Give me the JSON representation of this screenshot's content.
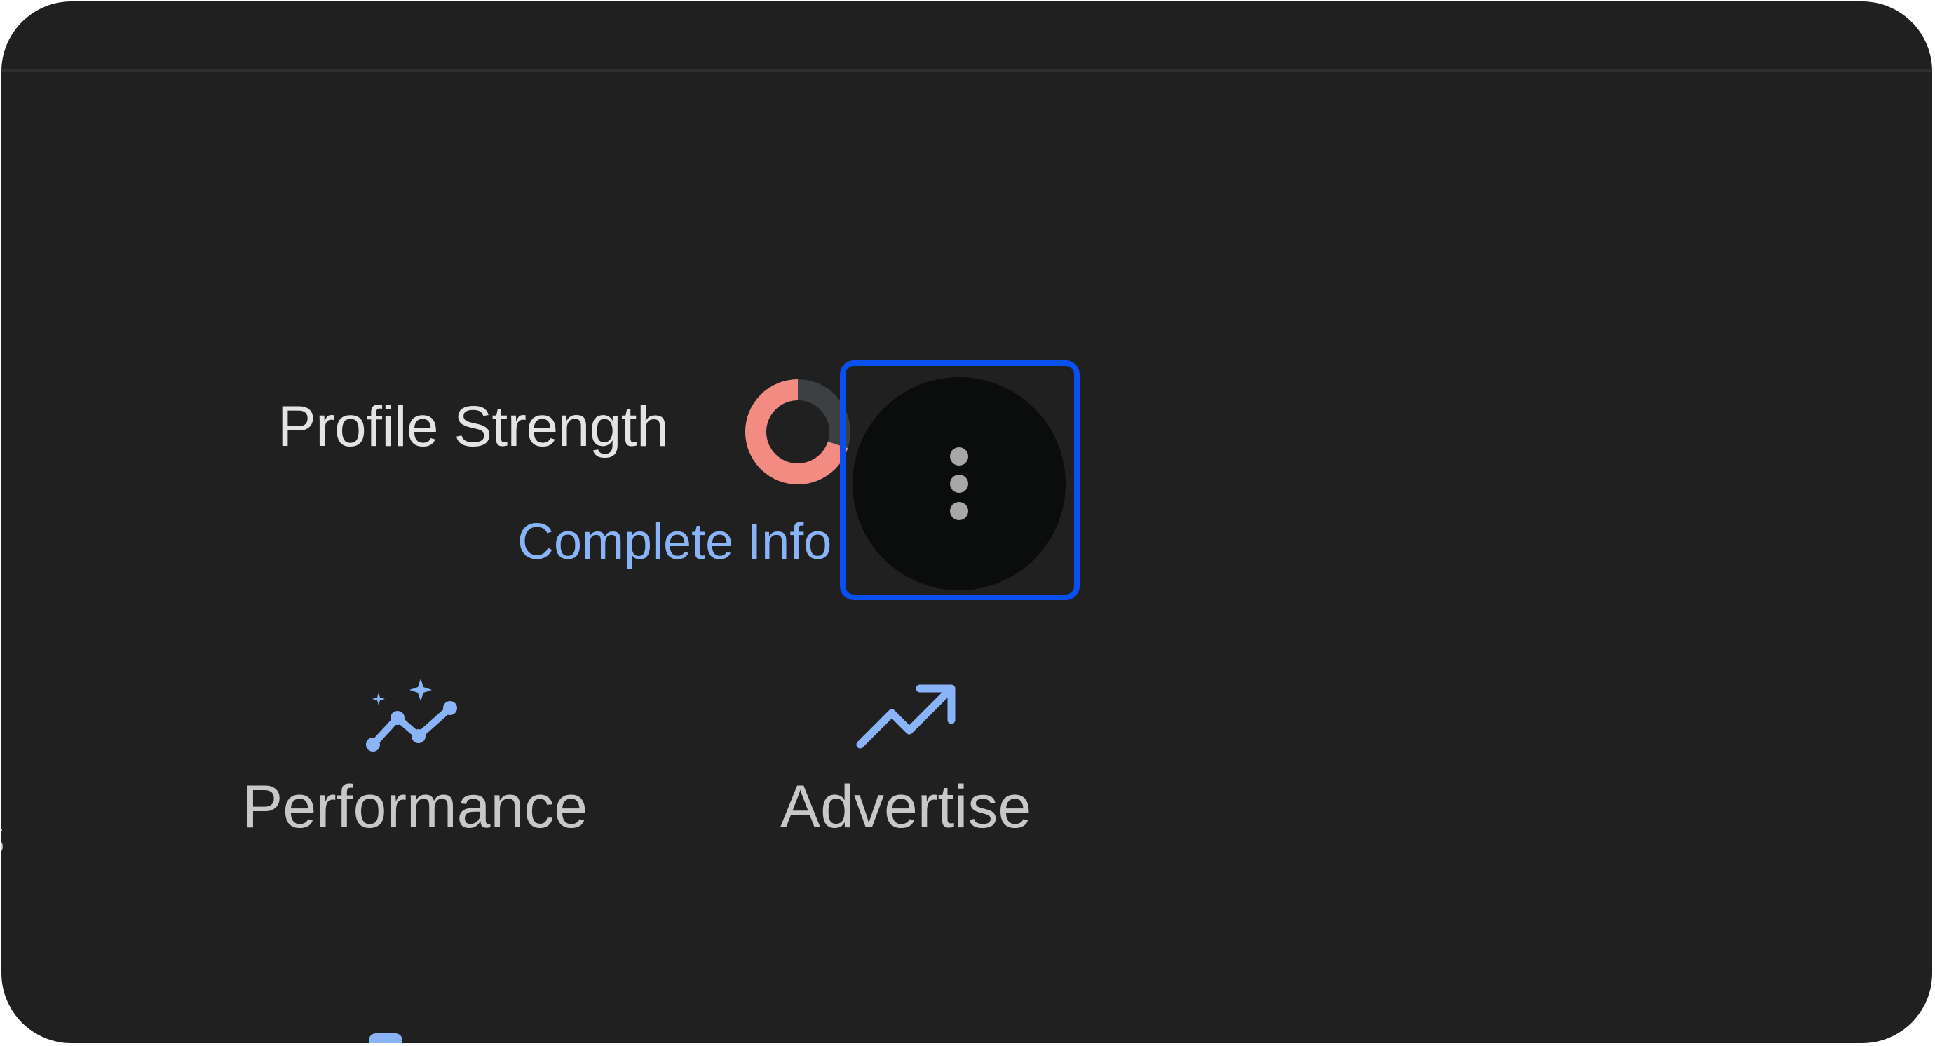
{
  "profile": {
    "strength_label": "Profile Strength",
    "complete_link": "Complete Info",
    "strength_ring": {
      "fraction": 0.7,
      "fill_color": "#f28b82",
      "track_color": "#3c4043"
    }
  },
  "more_menu": {
    "icon": "more-vertical-icon"
  },
  "actions": [
    {
      "label": "Performance",
      "icon": "performance-sparkle-icon",
      "icon_color": "#8ab4f8"
    },
    {
      "label": "Advertise",
      "icon": "trending-up-icon",
      "icon_color": "#8ab4f8"
    }
  ],
  "partial_left_action": {
    "visible_text": "s"
  },
  "colors": {
    "panel_bg": "#202020",
    "link": "#8ab4f8",
    "highlight": "#0a4ff0"
  }
}
